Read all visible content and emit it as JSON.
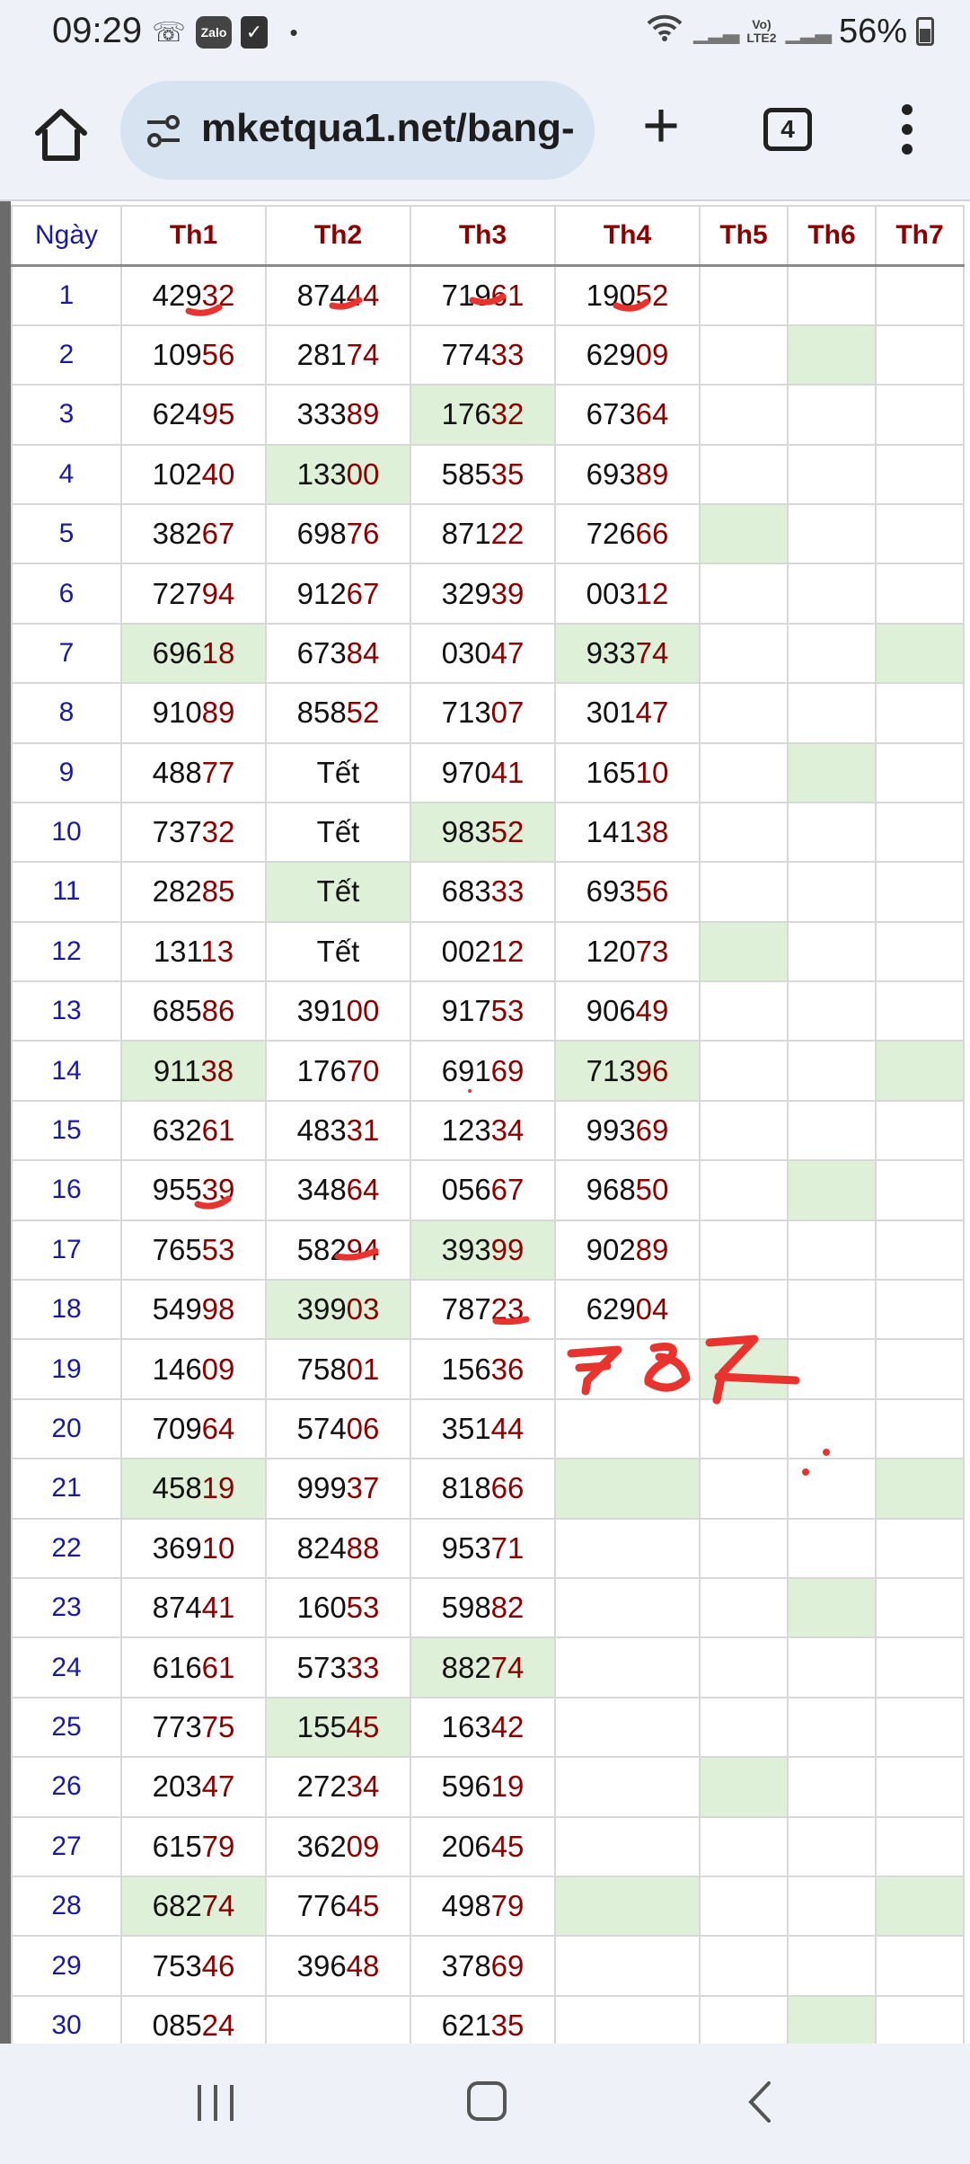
{
  "status_bar": {
    "time": "09:29",
    "zalo_label": "Zalo",
    "battery": "56%",
    "network": "LTE2",
    "volte": "Vo)"
  },
  "browser": {
    "url": "mketqua1.net/bang-",
    "tab_count": "4"
  },
  "table": {
    "headers": [
      "Ngày",
      "Th1",
      "Th2",
      "Th3",
      "Th4",
      "Th5",
      "Th6",
      "Th7"
    ],
    "rows": [
      {
        "day": "1",
        "cells": [
          {
            "p": "429",
            "s": "32"
          },
          {
            "p": "874",
            "s": "44"
          },
          {
            "p": "719",
            "s": "61"
          },
          {
            "p": "190",
            "s": "52"
          },
          {},
          {},
          {}
        ]
      },
      {
        "day": "2",
        "cells": [
          {
            "p": "109",
            "s": "56"
          },
          {
            "p": "281",
            "s": "74"
          },
          {
            "p": "774",
            "s": "33"
          },
          {
            "p": "629",
            "s": "09"
          },
          {},
          {
            "hl": true
          },
          {}
        ]
      },
      {
        "day": "3",
        "cells": [
          {
            "p": "624",
            "s": "95"
          },
          {
            "p": "333",
            "s": "89"
          },
          {
            "p": "176",
            "s": "32",
            "hl": true
          },
          {
            "p": "673",
            "s": "64"
          },
          {},
          {},
          {}
        ]
      },
      {
        "day": "4",
        "cells": [
          {
            "p": "102",
            "s": "40"
          },
          {
            "p": "133",
            "s": "00",
            "hl": true
          },
          {
            "p": "585",
            "s": "35"
          },
          {
            "p": "693",
            "s": "89"
          },
          {},
          {},
          {}
        ]
      },
      {
        "day": "5",
        "cells": [
          {
            "p": "382",
            "s": "67"
          },
          {
            "p": "698",
            "s": "76"
          },
          {
            "p": "871",
            "s": "22"
          },
          {
            "p": "726",
            "s": "66"
          },
          {
            "hl": true
          },
          {},
          {}
        ]
      },
      {
        "day": "6",
        "cells": [
          {
            "p": "727",
            "s": "94"
          },
          {
            "p": "912",
            "s": "67"
          },
          {
            "p": "329",
            "s": "39"
          },
          {
            "p": "003",
            "s": "12"
          },
          {},
          {},
          {}
        ]
      },
      {
        "day": "7",
        "cells": [
          {
            "p": "696",
            "s": "18",
            "hl": true
          },
          {
            "p": "673",
            "s": "84"
          },
          {
            "p": "030",
            "s": "47"
          },
          {
            "p": "933",
            "s": "74",
            "hl": true
          },
          {},
          {},
          {
            "hl": true
          }
        ]
      },
      {
        "day": "8",
        "cells": [
          {
            "p": "910",
            "s": "89"
          },
          {
            "p": "858",
            "s": "52"
          },
          {
            "p": "713",
            "s": "07"
          },
          {
            "p": "301",
            "s": "47"
          },
          {},
          {},
          {}
        ]
      },
      {
        "day": "9",
        "cells": [
          {
            "p": "488",
            "s": "77"
          },
          {
            "tet": "Tết"
          },
          {
            "p": "970",
            "s": "41"
          },
          {
            "p": "165",
            "s": "10"
          },
          {},
          {
            "hl": true
          },
          {}
        ]
      },
      {
        "day": "10",
        "cells": [
          {
            "p": "737",
            "s": "32"
          },
          {
            "tet": "Tết"
          },
          {
            "p": "983",
            "s": "52",
            "hl": true
          },
          {
            "p": "141",
            "s": "38"
          },
          {},
          {},
          {}
        ]
      },
      {
        "day": "11",
        "cells": [
          {
            "p": "282",
            "s": "85"
          },
          {
            "tet": "Tết",
            "hl": true
          },
          {
            "p": "683",
            "s": "33"
          },
          {
            "p": "693",
            "s": "56"
          },
          {},
          {},
          {}
        ]
      },
      {
        "day": "12",
        "cells": [
          {
            "p": "131",
            "s": "13"
          },
          {
            "tet": "Tết"
          },
          {
            "p": "002",
            "s": "12"
          },
          {
            "p": "120",
            "s": "73"
          },
          {
            "hl": true
          },
          {},
          {}
        ]
      },
      {
        "day": "13",
        "cells": [
          {
            "p": "685",
            "s": "86"
          },
          {
            "p": "391",
            "s": "00"
          },
          {
            "p": "917",
            "s": "53"
          },
          {
            "p": "906",
            "s": "49"
          },
          {},
          {},
          {}
        ]
      },
      {
        "day": "14",
        "cells": [
          {
            "p": "911",
            "s": "38",
            "hl": true
          },
          {
            "p": "176",
            "s": "70"
          },
          {
            "p": "691",
            "s": "69"
          },
          {
            "p": "713",
            "s": "96",
            "hl": true
          },
          {},
          {},
          {
            "hl": true
          }
        ]
      },
      {
        "day": "15",
        "cells": [
          {
            "p": "632",
            "s": "61"
          },
          {
            "p": "483",
            "s": "31"
          },
          {
            "p": "123",
            "s": "34"
          },
          {
            "p": "993",
            "s": "69"
          },
          {},
          {},
          {}
        ]
      },
      {
        "day": "16",
        "cells": [
          {
            "p": "955",
            "s": "39"
          },
          {
            "p": "348",
            "s": "64"
          },
          {
            "p": "056",
            "s": "67"
          },
          {
            "p": "968",
            "s": "50"
          },
          {},
          {
            "hl": true
          },
          {}
        ]
      },
      {
        "day": "17",
        "cells": [
          {
            "p": "765",
            "s": "53"
          },
          {
            "p": "582",
            "s": "94"
          },
          {
            "p": "393",
            "s": "99",
            "hl": true
          },
          {
            "p": "902",
            "s": "89"
          },
          {},
          {},
          {}
        ]
      },
      {
        "day": "18",
        "cells": [
          {
            "p": "549",
            "s": "98"
          },
          {
            "p": "399",
            "s": "03",
            "hl": true
          },
          {
            "p": "787",
            "s": "23"
          },
          {
            "p": "629",
            "s": "04"
          },
          {},
          {},
          {}
        ]
      },
      {
        "day": "19",
        "cells": [
          {
            "p": "146",
            "s": "09"
          },
          {
            "p": "758",
            "s": "01"
          },
          {
            "p": "156",
            "s": "36"
          },
          {},
          {
            "hl": true
          },
          {},
          {}
        ]
      },
      {
        "day": "20",
        "cells": [
          {
            "p": "709",
            "s": "64"
          },
          {
            "p": "574",
            "s": "06"
          },
          {
            "p": "351",
            "s": "44"
          },
          {},
          {},
          {},
          {}
        ]
      },
      {
        "day": "21",
        "cells": [
          {
            "p": "458",
            "s": "19",
            "hl": true
          },
          {
            "p": "999",
            "s": "37"
          },
          {
            "p": "818",
            "s": "66"
          },
          {
            "hl": true
          },
          {},
          {},
          {
            "hl": true
          }
        ]
      },
      {
        "day": "22",
        "cells": [
          {
            "p": "369",
            "s": "10"
          },
          {
            "p": "824",
            "s": "88"
          },
          {
            "p": "953",
            "s": "71"
          },
          {},
          {},
          {},
          {}
        ]
      },
      {
        "day": "23",
        "cells": [
          {
            "p": "874",
            "s": "41"
          },
          {
            "p": "160",
            "s": "53"
          },
          {
            "p": "598",
            "s": "82"
          },
          {},
          {},
          {
            "hl": true
          },
          {}
        ]
      },
      {
        "day": "24",
        "cells": [
          {
            "p": "616",
            "s": "61"
          },
          {
            "p": "573",
            "s": "33"
          },
          {
            "p": "882",
            "s": "74",
            "hl": true
          },
          {},
          {},
          {},
          {}
        ]
      },
      {
        "day": "25",
        "cells": [
          {
            "p": "773",
            "s": "75"
          },
          {
            "p": "155",
            "s": "45",
            "hl": true
          },
          {
            "p": "163",
            "s": "42"
          },
          {},
          {},
          {},
          {}
        ]
      },
      {
        "day": "26",
        "cells": [
          {
            "p": "203",
            "s": "47"
          },
          {
            "p": "272",
            "s": "34"
          },
          {
            "p": "596",
            "s": "19"
          },
          {},
          {
            "hl": true
          },
          {},
          {}
        ]
      },
      {
        "day": "27",
        "cells": [
          {
            "p": "615",
            "s": "79"
          },
          {
            "p": "362",
            "s": "09"
          },
          {
            "p": "206",
            "s": "45"
          },
          {},
          {},
          {},
          {}
        ]
      },
      {
        "day": "28",
        "cells": [
          {
            "p": "682",
            "s": "74",
            "hl": true
          },
          {
            "p": "776",
            "s": "45"
          },
          {
            "p": "498",
            "s": "79"
          },
          {
            "hl": true
          },
          {},
          {},
          {
            "hl": true
          }
        ]
      },
      {
        "day": "29",
        "cells": [
          {
            "p": "753",
            "s": "46"
          },
          {
            "p": "396",
            "s": "48"
          },
          {
            "p": "378",
            "s": "69"
          },
          {},
          {},
          {},
          {}
        ]
      },
      {
        "day": "30",
        "cells": [
          {
            "p": "085",
            "s": "24"
          },
          {},
          {
            "p": "621",
            "s": "35"
          },
          {},
          {},
          {
            "hl": true
          },
          {}
        ]
      }
    ]
  },
  "handwritten_note": "787",
  "colors": {
    "highlight": "#dff0d8",
    "header_red": "#8b0000",
    "day_blue": "#1a1aa0",
    "annotation_red": "#e8332e",
    "chrome_bg": "#eef2f8",
    "url_bg": "#d7e3f1"
  },
  "icons": {
    "home": "home-icon",
    "site_settings": "tune-icon",
    "new_tab": "plus-icon",
    "tab_switcher": "tabs-icon",
    "menu": "more-vert-icon"
  }
}
